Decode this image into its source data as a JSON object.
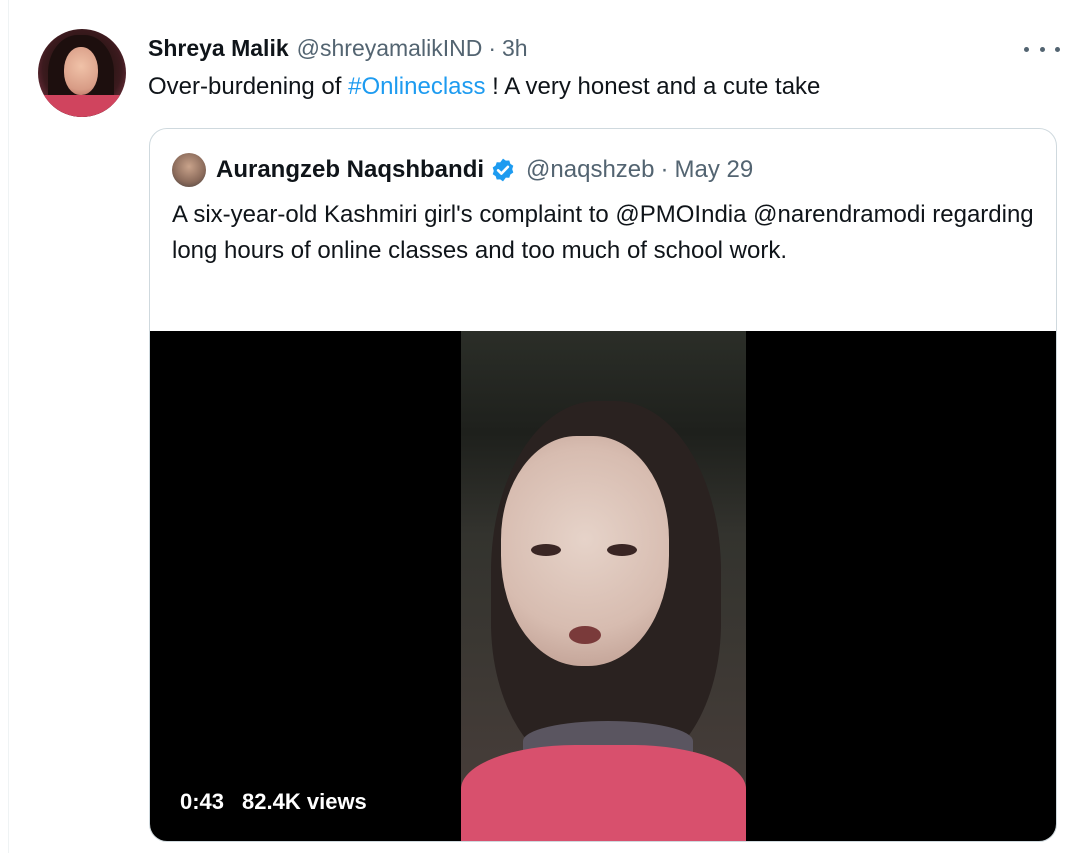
{
  "tweet": {
    "display_name": "Shreya Malik",
    "handle": "@shreyamalikIND",
    "separator": "·",
    "time": "3h",
    "text_before": "Over-burdening of ",
    "hashtag": "#Onlineclass",
    "text_after": " ! A very honest and a cute take",
    "more_icon": "more-horizontal-icon"
  },
  "quoted_tweet": {
    "display_name": "Aurangzeb Naqshbandi",
    "verified_icon": "verified-badge-icon",
    "handle": "@naqshzeb",
    "separator": "·",
    "date": "May 29",
    "text": "A six-year-old Kashmiri girl's complaint to @PMOIndia @narendramodi regarding long hours of online classes and too much of school work.",
    "video": {
      "duration": "0:43",
      "views": "82.4K views"
    }
  },
  "colors": {
    "link": "#1d9bf0",
    "secondary_text": "#536471",
    "border": "#cfd9de",
    "verified": "#1d9bf0"
  }
}
